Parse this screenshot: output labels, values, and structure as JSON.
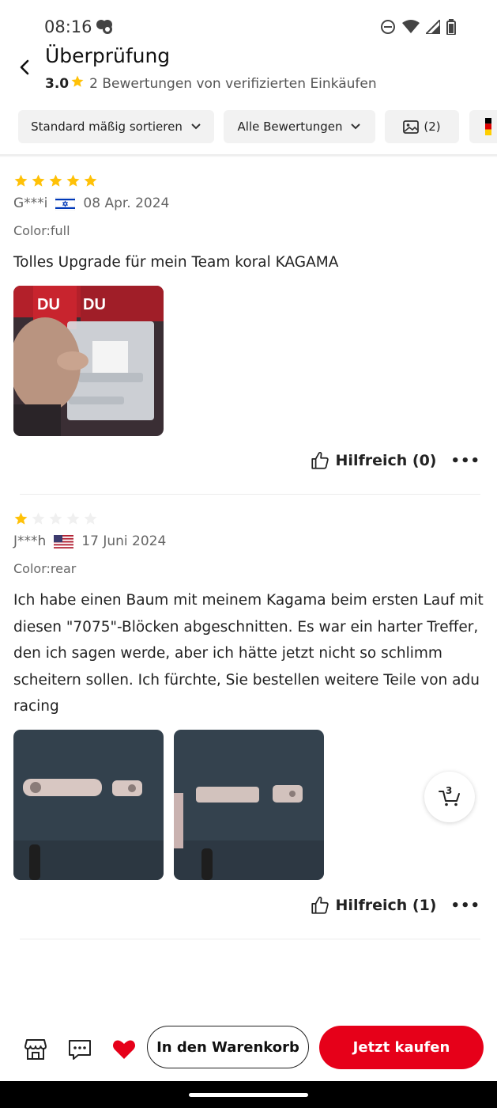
{
  "status_bar": {
    "time": "08:16"
  },
  "header": {
    "title": "Überprüfung",
    "rating": "3.0",
    "summary": "2 Bewertungen von verifizierten Einkäufen"
  },
  "filters": {
    "sort_label": "Standard mäßig sortieren",
    "all_label": "Alle Bewertungen",
    "photo_count": "(2)"
  },
  "reviews": [
    {
      "stars": 5,
      "user": "G***i",
      "country_flag": "israel-flag",
      "date": "08 Apr. 2024",
      "color": "Color:full",
      "text": "Tolles Upgrade für mein Team koral KAGAMA",
      "photo_count": 1,
      "helpful": "Hilfreich (0)"
    },
    {
      "stars": 1,
      "user": "J***h",
      "country_flag": "usa-flag",
      "date": "17 Juni 2024",
      "color": "Color:rear",
      "text": "Ich habe einen Baum mit meinem Kagama beim ersten Lauf mit diesen \"7075\"-Blöcken abgeschnitten. Es war ein harter Treffer, den ich sagen werde, aber ich hätte jetzt nicht so schlimm scheitern sollen. Ich fürchte, Sie bestellen weitere Teile von adu racing",
      "photo_count": 2,
      "helpful": "Hilfreich (1)"
    }
  ],
  "floating_cart": {
    "count": "3"
  },
  "bottom_bar": {
    "add_to_cart": "In den Warenkorb",
    "buy_now": "Jetzt kaufen"
  },
  "colors": {
    "accent": "#e60019",
    "star": "#ffc107",
    "chip_bg": "#f2f2f2"
  }
}
